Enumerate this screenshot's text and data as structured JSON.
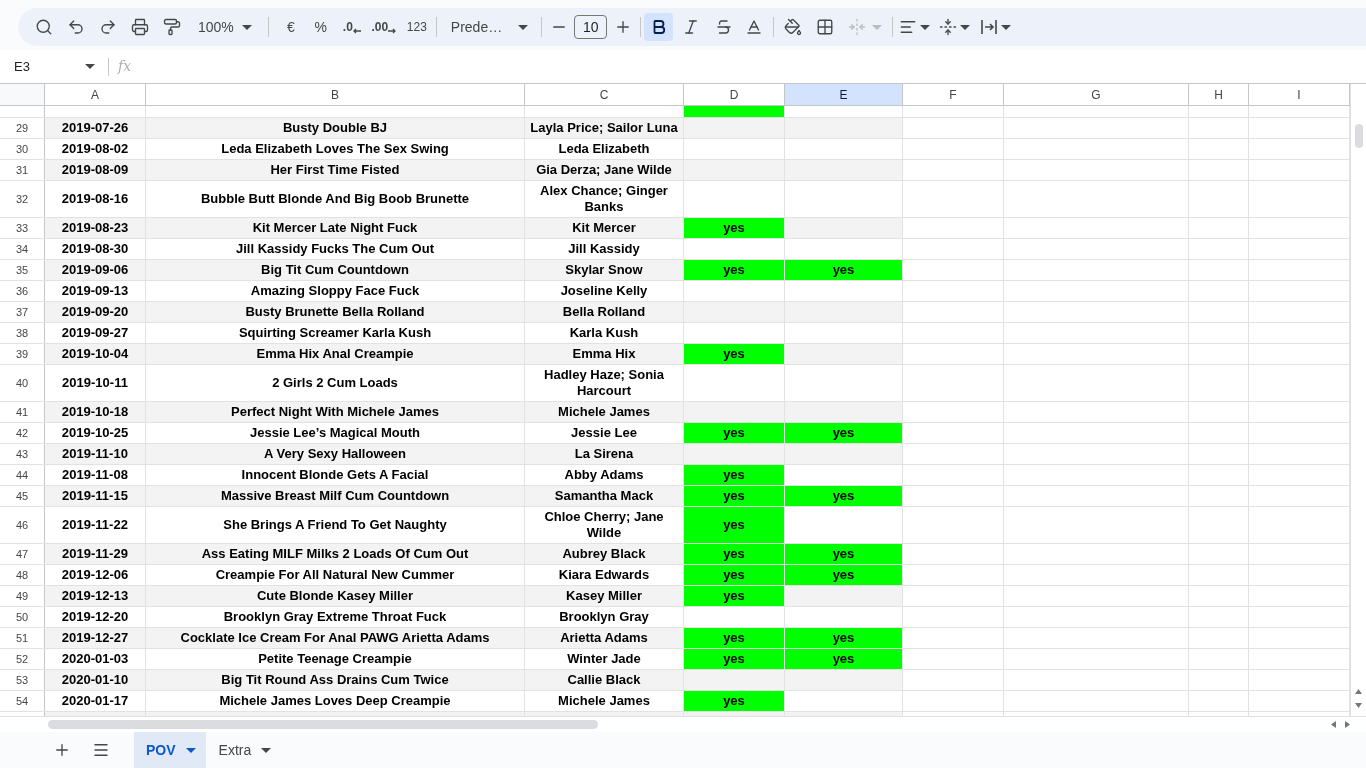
{
  "toolbar": {
    "zoom": "100%",
    "currency": "€",
    "percent": "%",
    "decrease_decimals": ".0",
    "increase_decimals": ".00",
    "number_format": "123",
    "font": "Prede…",
    "font_size": "10",
    "bold": true,
    "italic": false,
    "strikethrough": false,
    "merge_disabled": true
  },
  "formula_bar": {
    "cell_reference": "E3",
    "function_label": "fx"
  },
  "columns": [
    {
      "label": "A",
      "selected": false
    },
    {
      "label": "B",
      "selected": false
    },
    {
      "label": "C",
      "selected": false
    },
    {
      "label": "D",
      "selected": false
    },
    {
      "label": "E",
      "selected": true
    },
    {
      "label": "F",
      "selected": false
    },
    {
      "label": "G",
      "selected": false
    },
    {
      "label": "H",
      "selected": false
    },
    {
      "label": "I",
      "selected": false
    }
  ],
  "clipped_row": {
    "cells": {
      "D": {
        "highlighted": true
      }
    }
  },
  "rows": [
    {
      "number": "29",
      "cells": {
        "A": "2019-07-26",
        "B": "Busty Double BJ",
        "C": "Layla Price; Sailor Luna"
      }
    },
    {
      "number": "30",
      "cells": {
        "A": "2019-08-02",
        "B": "Leda Elizabeth Loves The Sex Swing",
        "C": "Leda Elizabeth"
      }
    },
    {
      "number": "31",
      "cells": {
        "A": "2019-08-09",
        "B": "Her First Time Fisted",
        "C": "Gia Derza; Jane Wilde"
      }
    },
    {
      "number": "32",
      "cells": {
        "A": "2019-08-16",
        "B": "Bubble Butt Blonde And Big Boob Brunette",
        "C": "Alex Chance; Ginger Banks"
      }
    },
    {
      "number": "33",
      "cells": {
        "A": "2019-08-23",
        "B": "Kit Mercer Late Night Fuck",
        "C": "Kit Mercer",
        "D": {
          "text": "yes",
          "highlighted": true
        }
      }
    },
    {
      "number": "34",
      "cells": {
        "A": "2019-08-30",
        "B": "Jill Kassidy Fucks The Cum Out",
        "C": "Jill Kassidy"
      }
    },
    {
      "number": "35",
      "cells": {
        "A": "2019-09-06",
        "B": "Big Tit Cum Countdown",
        "C": "Skylar Snow",
        "D": {
          "text": "yes",
          "highlighted": true
        },
        "E": {
          "text": "yes",
          "highlighted": true
        }
      }
    },
    {
      "number": "36",
      "cells": {
        "A": "2019-09-13",
        "B": "Amazing Sloppy Face Fuck",
        "C": "Joseline Kelly"
      }
    },
    {
      "number": "37",
      "cells": {
        "A": "2019-09-20",
        "B": "Busty Brunette Bella Rolland",
        "C": "Bella Rolland"
      }
    },
    {
      "number": "38",
      "cells": {
        "A": "2019-09-27",
        "B": "Squirting Screamer Karla Kush",
        "C": "Karla Kush"
      }
    },
    {
      "number": "39",
      "cells": {
        "A": "2019-10-04",
        "B": "Emma Hix Anal Creampie",
        "C": "Emma Hix",
        "D": {
          "text": "yes",
          "highlighted": true
        }
      }
    },
    {
      "number": "40",
      "cells": {
        "A": "2019-10-11",
        "B": "2 Girls 2 Cum Loads",
        "C": "Hadley Haze; Sonia Harcourt"
      }
    },
    {
      "number": "41",
      "cells": {
        "A": "2019-10-18",
        "B": "Perfect Night With Michele James",
        "C": "Michele James"
      }
    },
    {
      "number": "42",
      "cells": {
        "A": "2019-10-25",
        "B": "Jessie Lee’s Magical Mouth",
        "C": "Jessie Lee",
        "D": {
          "text": "yes",
          "highlighted": true
        },
        "E": {
          "text": "yes",
          "highlighted": true
        }
      }
    },
    {
      "number": "43",
      "cells": {
        "A": "2019-11-10",
        "B": "A Very Sexy Halloween",
        "C": "La Sirena"
      }
    },
    {
      "number": "44",
      "cells": {
        "A": "2019-11-08",
        "B": "Innocent Blonde Gets A Facial",
        "C": "Abby Adams",
        "D": {
          "text": "yes",
          "highlighted": true
        }
      }
    },
    {
      "number": "45",
      "cells": {
        "A": "2019-11-15",
        "B": "Massive Breast Milf Cum Countdown",
        "C": "Samantha Mack",
        "D": {
          "text": "yes",
          "highlighted": true
        },
        "E": {
          "text": "yes",
          "highlighted": true
        }
      }
    },
    {
      "number": "46",
      "cells": {
        "A": "2019-11-22",
        "B": "She Brings A Friend To Get Naughty",
        "C": "Chloe Cherry; Jane Wilde",
        "D": {
          "text": "yes",
          "highlighted": true
        }
      }
    },
    {
      "number": "47",
      "cells": {
        "A": "2019-11-29",
        "B": "Ass Eating MILF Milks 2 Loads Of Cum Out",
        "C": "Aubrey Black",
        "D": {
          "text": "yes",
          "highlighted": true
        },
        "E": {
          "text": "yes",
          "highlighted": true
        }
      }
    },
    {
      "number": "48",
      "cells": {
        "A": "2019-12-06",
        "B": "Creampie For All Natural New Cummer",
        "C": "Kiara Edwards",
        "D": {
          "text": "yes",
          "highlighted": true
        },
        "E": {
          "text": "yes",
          "highlighted": true
        }
      }
    },
    {
      "number": "49",
      "cells": {
        "A": "2019-12-13",
        "B": "Cute Blonde Kasey Miller",
        "C": "Kasey Miller",
        "D": {
          "text": "yes",
          "highlighted": true
        }
      }
    },
    {
      "number": "50",
      "cells": {
        "A": "2019-12-20",
        "B": "Brooklyn Gray Extreme Throat Fuck",
        "C": "Brooklyn Gray"
      }
    },
    {
      "number": "51",
      "cells": {
        "A": "2019-12-27",
        "B": "Cocklate Ice Cream For Anal PAWG Arietta Adams",
        "C": "Arietta Adams",
        "D": {
          "text": "yes",
          "highlighted": true
        },
        "E": {
          "text": "yes",
          "highlighted": true
        }
      }
    },
    {
      "number": "52",
      "cells": {
        "A": "2020-01-03",
        "B": "Petite Teenage Creampie",
        "C": "Winter Jade",
        "D": {
          "text": "yes",
          "highlighted": true
        },
        "E": {
          "text": "yes",
          "highlighted": true
        }
      }
    },
    {
      "number": "53",
      "cells": {
        "A": "2020-01-10",
        "B": "Big Tit Round Ass Drains Cum Twice",
        "C": "Callie Black"
      }
    },
    {
      "number": "54",
      "cells": {
        "A": "2020-01-17",
        "B": "Michele James Loves Deep Creampie",
        "C": "Michele James",
        "D": {
          "text": "yes",
          "highlighted": true
        }
      }
    }
  ],
  "sheet_tabs": [
    {
      "label": "POV",
      "selected": true
    },
    {
      "label": "Extra",
      "selected": false
    }
  ]
}
